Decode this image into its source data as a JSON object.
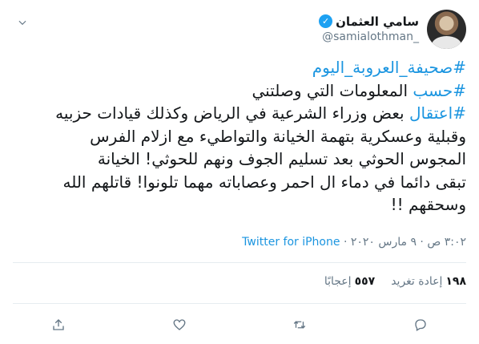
{
  "user": {
    "display_name": "سامي العثمان",
    "handle": "@samialothman_"
  },
  "tweet": {
    "line1": "#صحيفة_العروبة_اليوم",
    "line2_tag": "#حسب",
    "line2_text": " المعلومات التي وصلتني",
    "line3_tag": "#اعتقال",
    "line3_text": " بعض وزراء الشرعية في الرياض وكذلك قيادات حزبيه",
    "line4": "وقبلية وعسكرية بتهمة الخيانة والتواطيء مع ازلام الفرس",
    "line5": "المجوس الحوثي بعد تسليم الجوف ونهم للحوثي! الخيانة",
    "line6": "تبقى دائما في دماء ال احمر وعصاباته مهما تلونوا! قاتلهم الله",
    "line7": "وسحقهم !!"
  },
  "meta": {
    "time_date": "٣:٠٢ ص · ٩ مارس ٢٠٢٠ · ",
    "source": "Twitter for iPhone"
  },
  "stats": {
    "retweets_count": "١٩٨",
    "retweets_label": "إعادة تغريد",
    "likes_count": "٥٥٧",
    "likes_label": "إعجابًا"
  },
  "icons": {
    "verified": "verified-badge-icon",
    "more": "chevron-down-icon",
    "reply": "reply-icon",
    "retweet": "retweet-icon",
    "like": "heart-icon",
    "share": "share-icon"
  },
  "colors": {
    "link": "#1b95e0",
    "verified": "#1da1f2",
    "secondary_text": "#657786"
  }
}
